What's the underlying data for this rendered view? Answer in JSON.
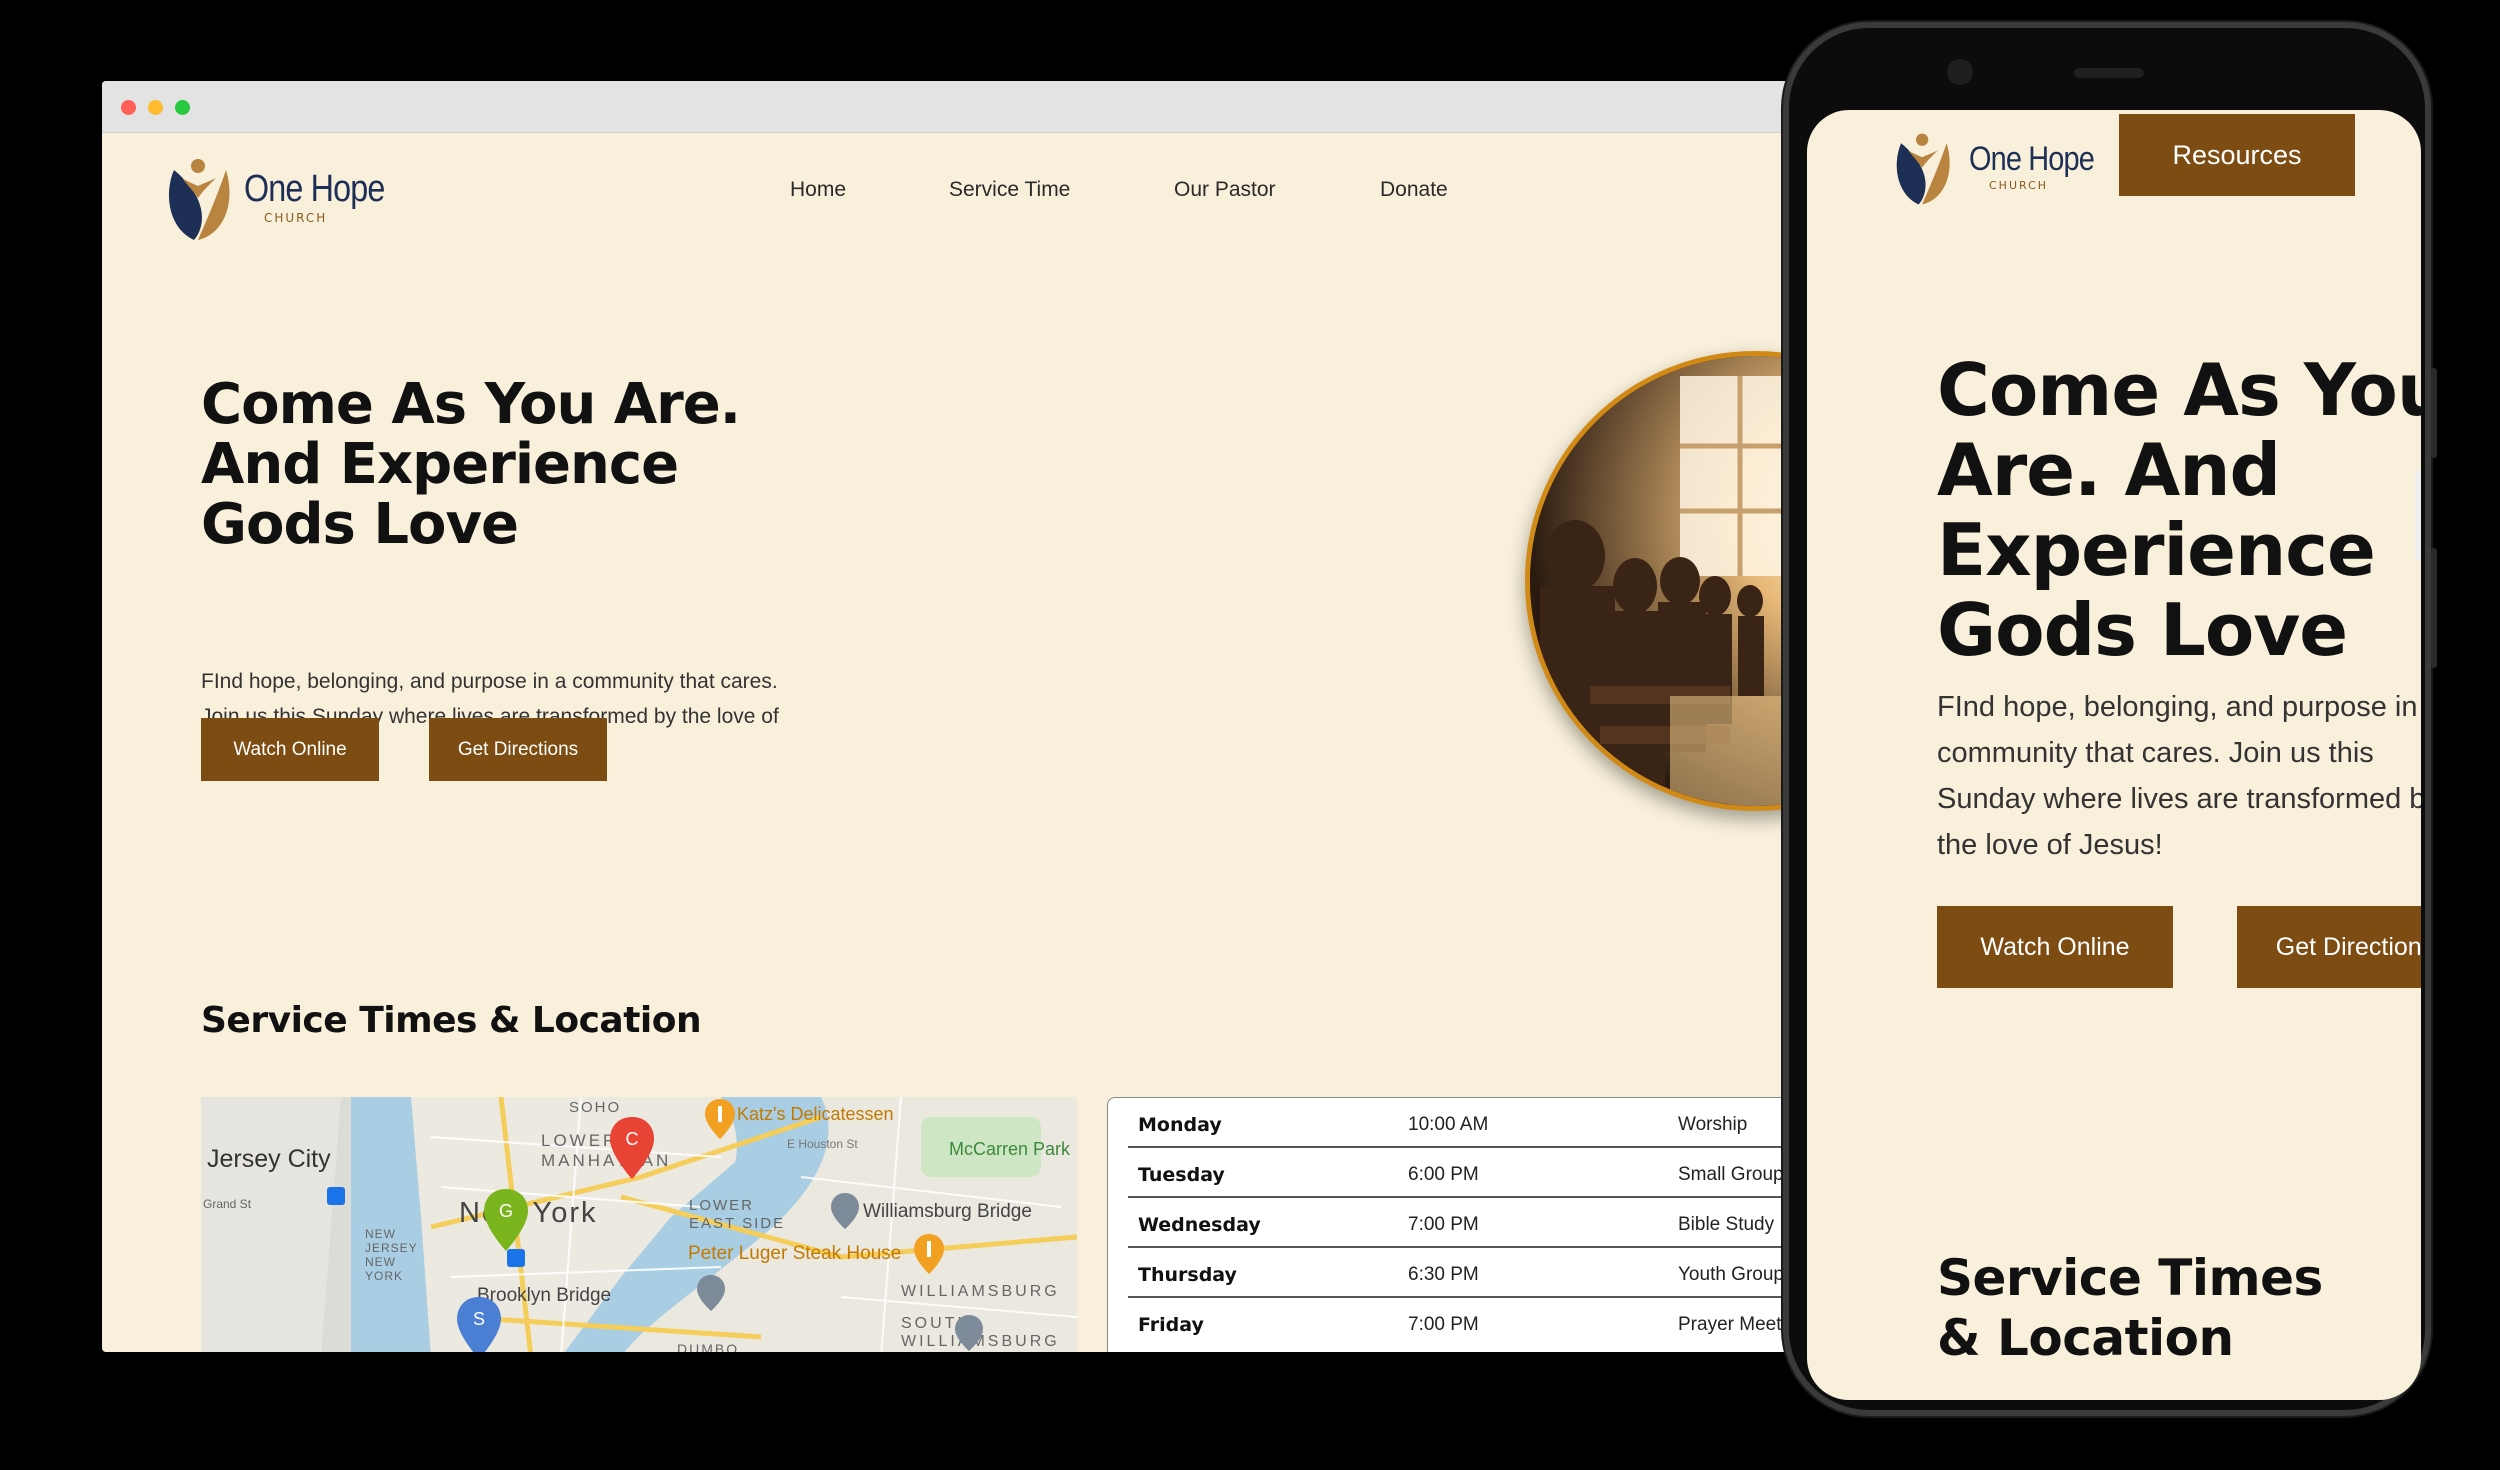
{
  "site": {
    "logo_name": "One Hope",
    "logo_sub": "CHURCH"
  },
  "nav": [
    {
      "label": "Home"
    },
    {
      "label": "Service Time"
    },
    {
      "label": "Our Pastor"
    },
    {
      "label": "Donate"
    }
  ],
  "hero": {
    "title_lines": [
      "Come As You Are.",
      "And Experience",
      "Gods Love"
    ],
    "text": "FInd hope, belonging, and purpose in a community that cares. Join us this Sunday where lives are transformed by the love of Jesus!",
    "watch_label": "Watch Online",
    "directions_label": "Get Directions"
  },
  "section_title": "Service Times & Location",
  "map": {
    "labels": {
      "jersey_city": "Jersey City",
      "soho": "SOHO",
      "lower_manhattan": "LOWER MANHATTAN",
      "new_york": "New York",
      "katz": "Katz's Delicatessen",
      "mccarren": "McCarren Park",
      "lower_east_side": "LOWER EAST SIDE",
      "williamsburg_bridge": "Williamsburg Bridge",
      "peter_luger": "Peter Luger Steak House",
      "brooklyn_bridge": "Brooklyn Bridge",
      "williamsburg": "WILLIAMSBURG",
      "south_williamsburg": "SOUTH WILLIAMSBURG",
      "dumbo": "DUMBO",
      "grand_st": "Grand St",
      "new_jersey_new_york": "NEW JERSEY NEW YORK",
      "e_houston": "E Houston St"
    },
    "markers": {
      "c": "C",
      "g": "G",
      "s": "S"
    }
  },
  "schedule": [
    {
      "day": "Monday",
      "time": "10:00 AM",
      "event": "Worship"
    },
    {
      "day": "Tuesday",
      "time": "6:00 PM",
      "event": "Small Group"
    },
    {
      "day": "Wednesday",
      "time": "7:00 PM",
      "event": "Bible Study"
    },
    {
      "day": "Thursday",
      "time": "6:30 PM",
      "event": "Youth Group"
    },
    {
      "day": "Friday",
      "time": "7:00 PM",
      "event": "Prayer Meeting"
    }
  ],
  "mobile": {
    "resources_label": "Resources",
    "title_lines": [
      "Come As You",
      "Are. And",
      "Experience",
      "Gods Love"
    ],
    "text": "FInd hope, belonging, and purpose in a community that cares. Join us this Sunday where lives are transformed by the love of Jesus!",
    "watch_label": "Watch Online",
    "directions_label": "Get Directions",
    "section_lines": [
      "Service Times",
      "& Location"
    ]
  },
  "colors": {
    "page_bg": "#f8f0db",
    "brand_brown": "#7d4c12",
    "brand_navy": "#1e2f56",
    "accent_gold": "#d08a15"
  }
}
